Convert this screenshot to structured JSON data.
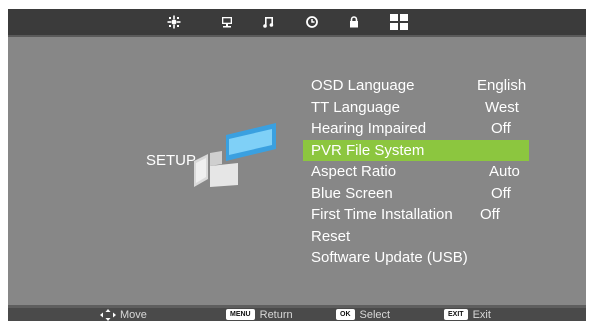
{
  "topbar": {
    "tabs": [
      {
        "icon": "picture-icon"
      },
      {
        "icon": "monitor-icon"
      },
      {
        "icon": "music-note-icon"
      },
      {
        "icon": "clock-icon"
      },
      {
        "icon": "lock-icon"
      },
      {
        "icon": "setup-grid-icon"
      }
    ],
    "active_tab": "setup-grid-icon"
  },
  "page_title": "SETUP",
  "menu": {
    "selected_color": "#8cc63f",
    "items": [
      {
        "label": "OSD Language",
        "value": "English"
      },
      {
        "label": "TT Language",
        "value": "West"
      },
      {
        "label": "Hearing Impaired",
        "value": "Off"
      },
      {
        "label": "PVR File System",
        "value": ""
      },
      {
        "label": "Aspect Ratio",
        "value": "Auto"
      },
      {
        "label": "Blue Screen",
        "value": "Off"
      },
      {
        "label": "First Time Installation",
        "value": "Off"
      },
      {
        "label": "Reset",
        "value": ""
      },
      {
        "label": "Software Update (USB)",
        "value": ""
      }
    ]
  },
  "footer": {
    "move": {
      "icon": "dpad-arrows-icon",
      "label": "Move"
    },
    "return": {
      "key": "MENU",
      "label": "Return"
    },
    "select": {
      "key": "OK",
      "label": "Select"
    },
    "exit": {
      "key": "EXIT",
      "label": "Exit"
    }
  }
}
